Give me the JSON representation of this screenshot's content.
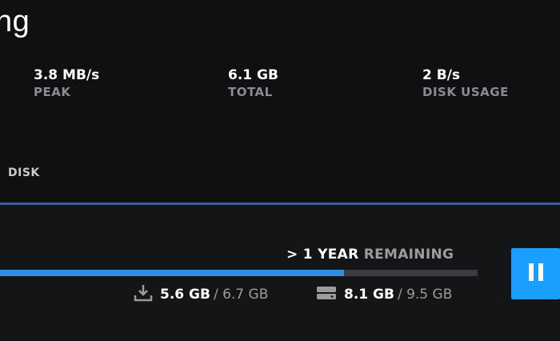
{
  "header": {
    "title": "ng"
  },
  "stats": [
    {
      "value": "3.8 MB/s",
      "label": "PEAK"
    },
    {
      "value": "6.1 GB",
      "label": "TOTAL"
    },
    {
      "value": "2 B/s",
      "label": "DISK USAGE"
    }
  ],
  "disk_section": {
    "label": "DISK"
  },
  "download": {
    "time_remaining": "> 1 YEAR",
    "remaining_label": "REMAINING",
    "progress_fraction": 0.72,
    "downloaded": "5.6 GB",
    "download_total": "/ 6.7 GB",
    "disk_used": "8.1 GB",
    "disk_total": "/ 9.5 GB",
    "download_icon": "download-icon",
    "disk_icon": "hard-drive-icon",
    "pause_icon": "pause-icon"
  },
  "colors": {
    "accent": "#1a9fff",
    "progress": "#2f8fe0",
    "divider": "#3d5f99",
    "muted_text": "#8a8c8f",
    "background": "#0f1012"
  }
}
